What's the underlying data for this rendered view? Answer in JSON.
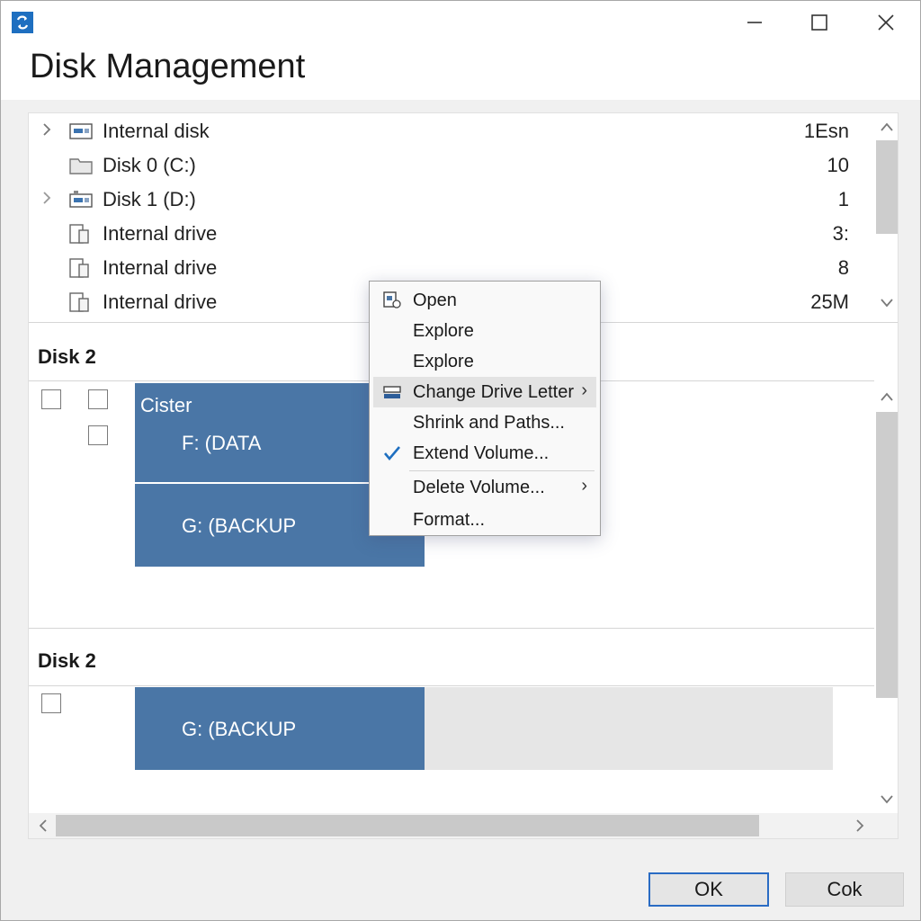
{
  "window": {
    "title": "Disk Management",
    "app_icon": "disk-management-icon",
    "controls": {
      "minimize": "—",
      "maximize": "☐",
      "close": "✕"
    }
  },
  "tree": {
    "rows": [
      {
        "label": "Internal disk",
        "size": "1Esn",
        "expandable": true,
        "icon": "disk-icon"
      },
      {
        "label": "Disk 0 (C:)",
        "size": "10",
        "expandable": false,
        "icon": "folder-icon"
      },
      {
        "label": "Disk 1 (D:)",
        "size": "1",
        "expandable": true,
        "icon": "drive-icon"
      },
      {
        "label": "Internal drive",
        "size": "3:",
        "expandable": false,
        "icon": "document-drive-icon"
      },
      {
        "label": "Internal drive",
        "size": "8",
        "expandable": false,
        "icon": "document-drive-icon"
      },
      {
        "label": "Internal drive",
        "size": "25M",
        "expandable": false,
        "icon": "document-drive-icon"
      }
    ]
  },
  "disks": [
    {
      "title": "Disk 2",
      "volumes": [
        {
          "header": "Cister",
          "label": "F: (DATA"
        },
        {
          "label": "G: (BACKUP"
        }
      ]
    },
    {
      "title": "Disk 2",
      "volumes": [
        {
          "label": "G: (BACKUP"
        }
      ]
    }
  ],
  "context_menu": {
    "items": [
      {
        "label": "Open",
        "icon": "open-icon"
      },
      {
        "label": "Explore"
      },
      {
        "label": "Explore"
      },
      {
        "label": "Change Drive Letter",
        "icon": "drive-letter-icon",
        "submenu": "›"
      },
      {
        "label": "Shrink  and Paths..."
      },
      {
        "label": "Extend Volume...",
        "icon": "checkmark-icon"
      },
      {
        "label": "Delete Volume...",
        "submenu": "›"
      },
      {
        "label": "Format..."
      }
    ]
  },
  "buttons": {
    "ok": "OK",
    "cancel": "Cok"
  },
  "colors": {
    "volume_fill": "#4a76a6",
    "accent": "#2a6cc4",
    "unallocated": "#e6e6e6"
  }
}
